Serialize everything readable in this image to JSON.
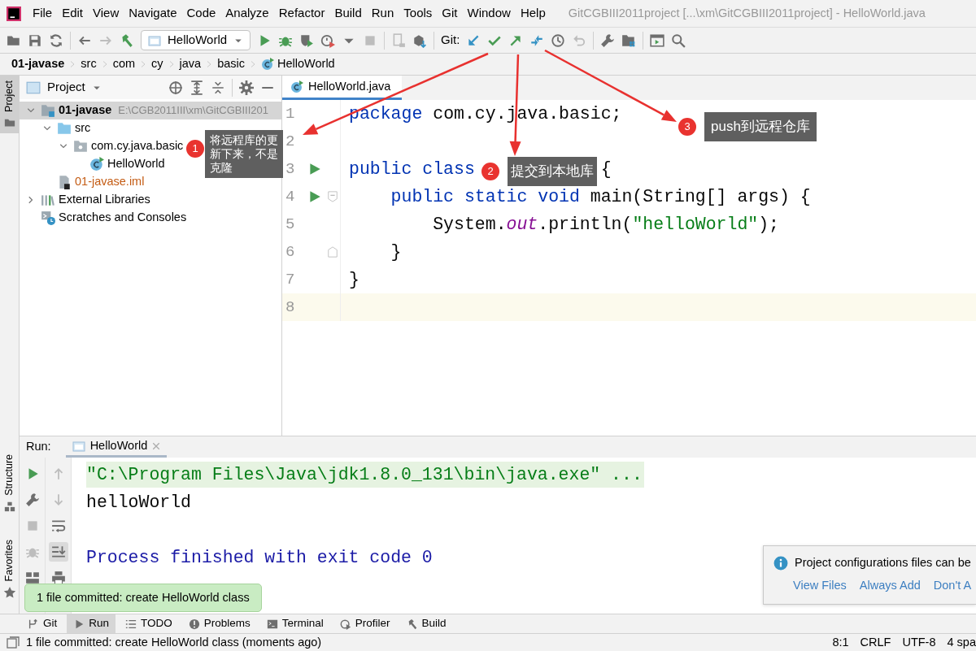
{
  "window": {
    "title": "GitCGBIII2011project [...\\xm\\GitCGBIII2011project] - HelloWorld.java"
  },
  "menu": [
    "File",
    "Edit",
    "View",
    "Navigate",
    "Code",
    "Analyze",
    "Refactor",
    "Build",
    "Run",
    "Tools",
    "Git",
    "Window",
    "Help"
  ],
  "toolbar": [
    {
      "kind": "icon",
      "disabled": false
    },
    {
      "kind": "icon",
      "disabled": false
    },
    {
      "kind": "icon",
      "disabled": false
    },
    {
      "kind": "separator"
    },
    {
      "kind": "icon",
      "disabled": false
    },
    {
      "kind": "icon",
      "disabled": true
    },
    {
      "kind": "icon",
      "disabled": false
    },
    {
      "kind": "run_config",
      "label": "HelloWorld"
    },
    {
      "kind": "icon",
      "disabled": false
    },
    {
      "kind": "icon",
      "disabled": false
    },
    {
      "kind": "icon",
      "disabled": false
    },
    {
      "kind": "icon",
      "disabled": false
    },
    {
      "kind": "icon",
      "disabled": false
    },
    {
      "kind": "icon",
      "disabled": true
    },
    {
      "kind": "separator"
    },
    {
      "kind": "icon",
      "disabled": true
    },
    {
      "kind": "icon",
      "disabled": false
    },
    {
      "kind": "separator"
    },
    {
      "kind": "label",
      "text": "Git:"
    },
    {
      "kind": "icon",
      "disabled": false
    },
    {
      "kind": "icon",
      "disabled": false
    },
    {
      "kind": "icon",
      "disabled": false
    },
    {
      "kind": "icon",
      "disabled": false
    },
    {
      "kind": "icon",
      "disabled": false
    },
    {
      "kind": "icon",
      "disabled": true
    },
    {
      "kind": "separator"
    },
    {
      "kind": "icon",
      "disabled": false
    },
    {
      "kind": "icon",
      "disabled": false
    },
    {
      "kind": "separator"
    },
    {
      "kind": "icon",
      "disabled": false
    },
    {
      "kind": "icon",
      "disabled": false
    }
  ],
  "breadcrumb": [
    "01-javase",
    "src",
    "com",
    "cy",
    "java",
    "basic",
    "HelloWorld"
  ],
  "side_tabs_top": [
    {
      "label": "Project",
      "selected": true
    }
  ],
  "side_tabs_bottom": [
    {
      "label": "Structure",
      "selected": false
    },
    {
      "label": "Favorites",
      "selected": false
    }
  ],
  "project_panel": {
    "title": "Project",
    "tree": [
      {
        "label": "01-javase",
        "detail": "E:\\CGB2011III\\xm\\GitCGBIII201",
        "kind": "module",
        "color": "#000000",
        "selected": true,
        "expanded": true,
        "children": [
          {
            "label": "src",
            "kind": "folder",
            "color": "#000000",
            "selected": false,
            "expanded": true,
            "children": [
              {
                "label": "com.cy.java.basic",
                "kind": "package",
                "color": "#000000",
                "selected": false,
                "expanded": true,
                "children": [
                  {
                    "label": "HelloWorld",
                    "kind": "class",
                    "color": "#000000",
                    "selected": false
                  }
                ]
              }
            ]
          },
          {
            "label": "01-javase.iml",
            "kind": "file",
            "color": "#c45c14",
            "selected": false
          }
        ]
      },
      {
        "label": "External Libraries",
        "kind": "libraries",
        "color": "#000000",
        "selected": false,
        "expanded": false
      },
      {
        "label": "Scratches and Consoles",
        "kind": "scratches",
        "color": "#000000",
        "selected": false
      }
    ]
  },
  "editor": {
    "tabs": [
      {
        "label": "HelloWorld.java",
        "selected": true
      }
    ],
    "lines": [
      {
        "number": "1",
        "run": false,
        "fold_start": false,
        "fold_end": false,
        "current": false,
        "tokens": [
          {
            "kind": "keyword",
            "text": "package"
          },
          {
            "kind": "plain",
            "text": " com.cy.java.basic;"
          }
        ]
      },
      {
        "number": "2",
        "run": false,
        "fold_start": false,
        "fold_end": false,
        "current": false
      },
      {
        "number": "3",
        "run": true,
        "fold_start": false,
        "fold_end": false,
        "current": false,
        "covered": true,
        "tokens": [
          {
            "kind": "keyword",
            "text": "public class"
          },
          {
            "kind": "plain",
            "text": "{"
          }
        ]
      },
      {
        "number": "4",
        "run": true,
        "fold_start": true,
        "fold_end": false,
        "current": false,
        "tokens": [
          {
            "kind": "keyword",
            "text": "    public static void"
          },
          {
            "kind": "plain",
            "text": " main(String[] args) {"
          }
        ]
      },
      {
        "number": "5",
        "run": false,
        "fold_start": false,
        "fold_end": false,
        "current": false,
        "tokens": [
          {
            "kind": "plain",
            "text": "        System."
          },
          {
            "kind": "field",
            "text": "out"
          },
          {
            "kind": "plain",
            "text": ".println("
          },
          {
            "kind": "string",
            "text": "\"helloWorld\""
          },
          {
            "kind": "plain",
            "text": ");"
          }
        ]
      },
      {
        "number": "6",
        "run": false,
        "fold_start": false,
        "fold_end": true,
        "current": false,
        "tokens": [
          {
            "kind": "plain",
            "text": "    }"
          }
        ]
      },
      {
        "number": "7",
        "run": false,
        "fold_start": false,
        "fold_end": false,
        "current": false,
        "tokens": [
          {
            "kind": "plain",
            "text": "}"
          }
        ]
      },
      {
        "number": "8",
        "run": false,
        "fold_start": false,
        "fold_end": false,
        "current": true
      }
    ]
  },
  "run_panel": {
    "label": "Run:",
    "tabs": [
      {
        "label": "HelloWorld",
        "selected": true
      }
    ],
    "tools_1": [
      {
        "disabled": false
      },
      {
        "disabled": false
      },
      {
        "disabled": true
      },
      {
        "disabled": true
      },
      {
        "disabled": false
      }
    ],
    "tools_2": [
      {
        "disabled": true,
        "on": false
      },
      {
        "disabled": true,
        "on": false
      },
      {
        "disabled": false,
        "on": false
      },
      {
        "disabled": false,
        "on": true
      },
      {
        "disabled": false,
        "on": false
      }
    ],
    "console": [
      {
        "kind": "command",
        "text": "\"C:\\Program Files\\Java\\jdk1.8.0_131\\bin\\java.exe\" ..."
      },
      {
        "kind": "output",
        "text": "helloWorld"
      },
      {
        "kind": "blank"
      },
      {
        "kind": "exit",
        "text": "Process finished with exit code 0"
      }
    ]
  },
  "annotations": [
    {
      "number": "1",
      "text": "将远程库的更新下来，不是克隆"
    },
    {
      "number": "2",
      "text": "提交到本地库"
    },
    {
      "number": "3",
      "text": "push到远程仓库"
    }
  ],
  "toast": {
    "text": "1 file committed: create HelloWorld class"
  },
  "notification": {
    "text": "Project configurations files can be",
    "links": [
      "View Files",
      "Always Add",
      "Don't A"
    ]
  },
  "tool_tabs": [
    {
      "label": "Git",
      "selected": false
    },
    {
      "label": "Run",
      "selected": true
    },
    {
      "label": "TODO",
      "selected": false
    },
    {
      "label": "Problems",
      "selected": false
    },
    {
      "label": "Terminal",
      "selected": false
    },
    {
      "label": "Profiler",
      "selected": false
    },
    {
      "label": "Build",
      "selected": false
    }
  ],
  "status_bar": {
    "message": "1 file committed: create HelloWorld class (moments ago)",
    "items": [
      "8:1",
      "CRLF",
      "UTF-8",
      "4 spa"
    ]
  }
}
